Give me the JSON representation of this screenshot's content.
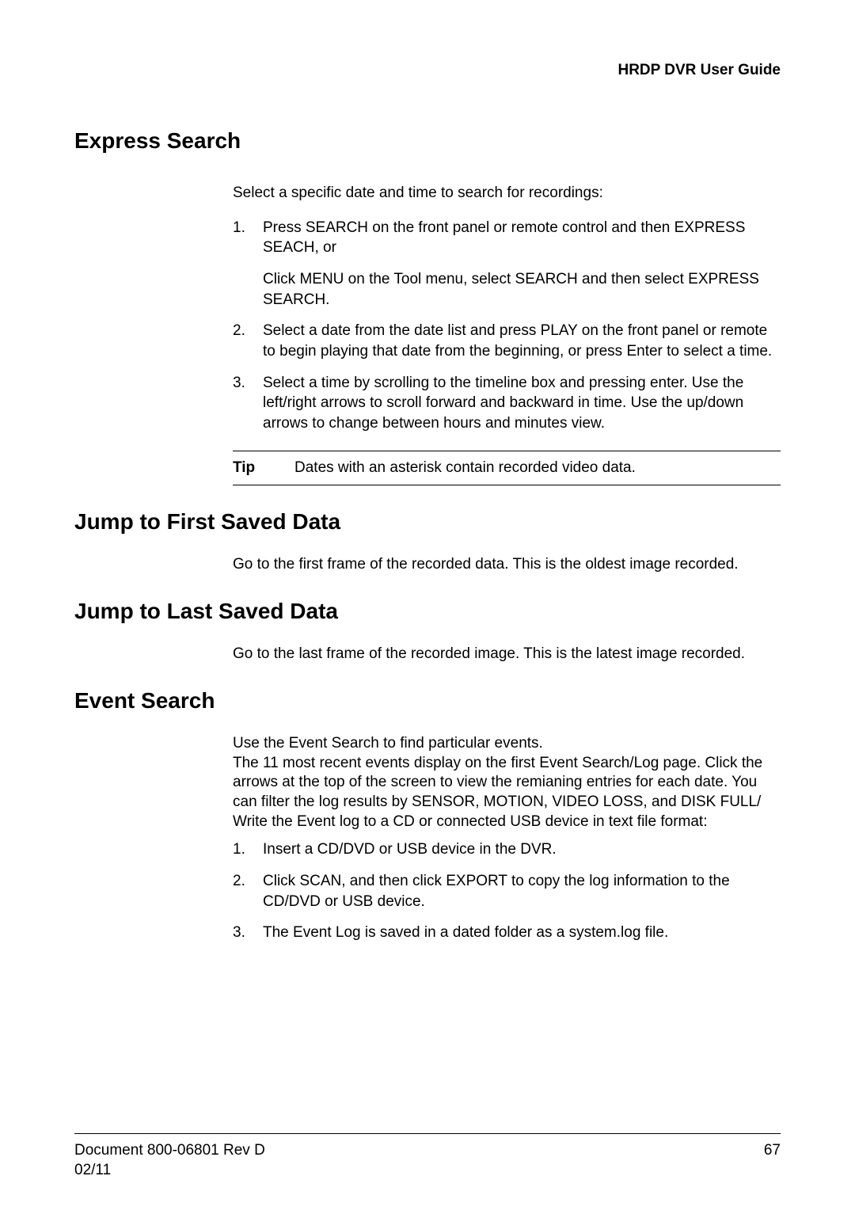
{
  "header": {
    "title": "HRDP DVR User Guide"
  },
  "sections": {
    "express_search": {
      "heading": "Express Search",
      "intro": "Select a specific date and time to search for recordings:",
      "items": [
        {
          "main": "Press SEARCH on the front panel or remote control and then EXPRESS SEACH, or",
          "sub": "Click MENU on the Tool menu, select SEARCH and then select EXPRESS SEARCH."
        },
        {
          "main": "Select a date from the date list and press PLAY on the front panel or remote to begin playing that date from the beginning, or press Enter to select a time."
        },
        {
          "main": "Select a time by scrolling to the timeline box and pressing enter. Use the left/right arrows to scroll forward and backward in time. Use the up/down arrows to change between hours and minutes view."
        }
      ],
      "tip_label": "Tip",
      "tip_text": "Dates with an asterisk contain recorded video data."
    },
    "jump_first": {
      "heading": "Jump to First Saved Data",
      "text": "Go to the first frame of the recorded data. This is the oldest image recorded."
    },
    "jump_last": {
      "heading": "Jump to Last Saved Data",
      "text": "Go to the last frame of the recorded image. This is the latest image recorded."
    },
    "event_search": {
      "heading": "Event Search",
      "paragraphs": [
        "Use the Event Search to find particular events.",
        "The 11 most recent events display on the first Event Search/Log page. Click the arrows at the top of the screen to view the remianing entries for each date. You can filter the log results by SENSOR, MOTION, VIDEO LOSS, and DISK FULL/",
        "Write the Event log to a CD or connected USB device in text file format:"
      ],
      "items": [
        "Insert a CD/DVD or USB device in the DVR.",
        "Click SCAN, and then click EXPORT to copy the log information to the CD/DVD or USB device.",
        "The Event Log is saved in a dated folder as a system.log file."
      ]
    }
  },
  "footer": {
    "doc_id": "Document 800-06801  Rev D",
    "date": "02/11",
    "page": "67"
  }
}
